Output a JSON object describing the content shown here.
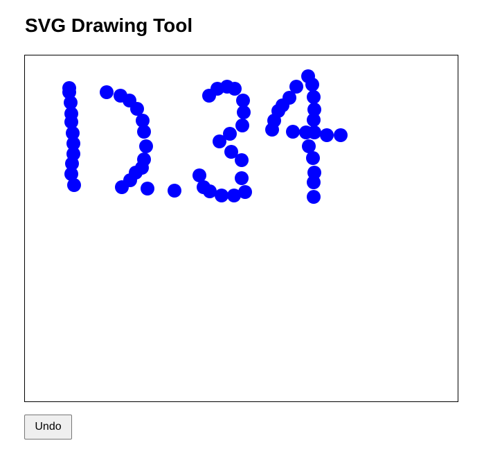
{
  "page": {
    "title": "SVG Drawing Tool"
  },
  "drawing": {
    "stroke_color": "#0000ff",
    "background_color": "#ffffff",
    "border_color": "#000000"
  },
  "toolbar": {
    "undo_label": "Undo"
  }
}
